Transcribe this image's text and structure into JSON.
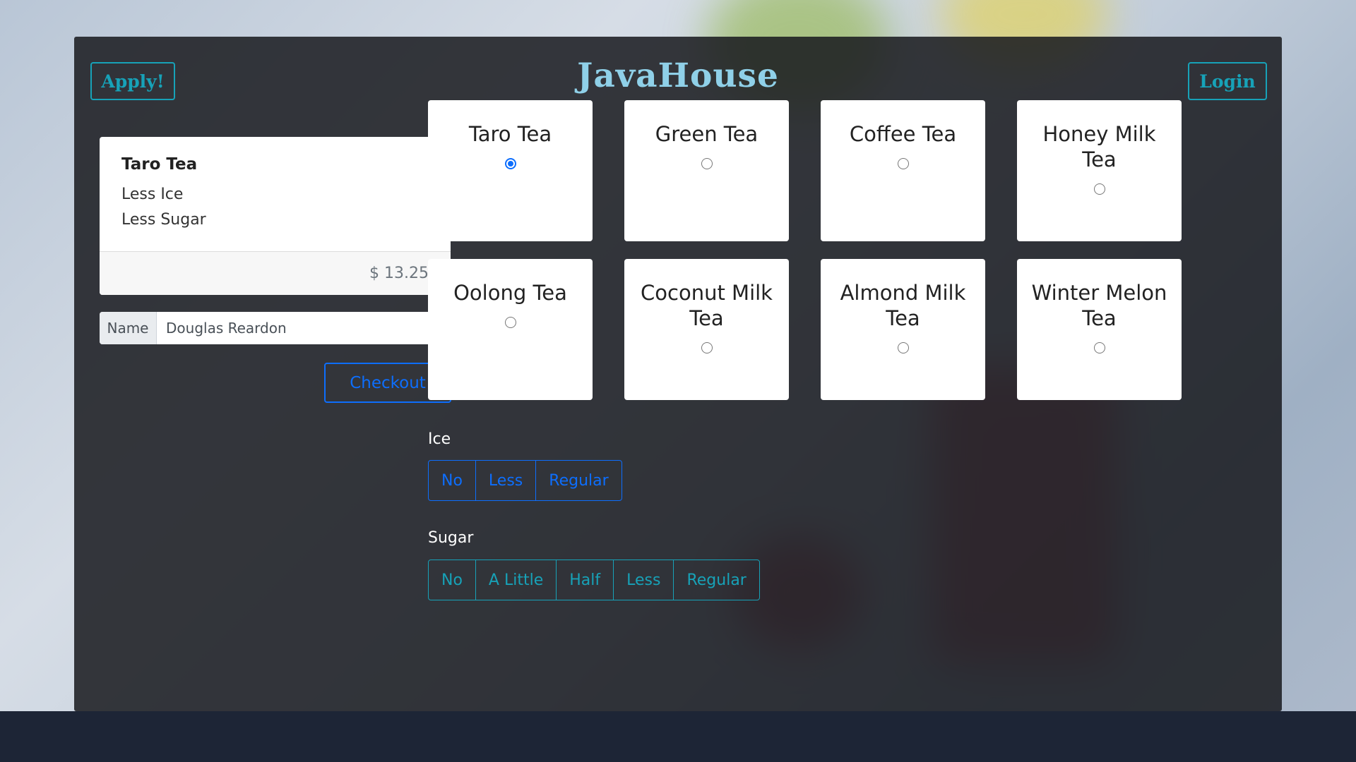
{
  "header": {
    "brand": "JavaHouse",
    "apply_label": "Apply!",
    "login_label": "Login"
  },
  "order": {
    "item": "Taro Tea",
    "ice": "Less Ice",
    "sugar": "Less Sugar",
    "price": "$ 13.25"
  },
  "name_field": {
    "label": "Name",
    "value": "Douglas Reardon"
  },
  "checkout_label": "Checkout",
  "teas": [
    {
      "name": "Taro Tea",
      "selected": true
    },
    {
      "name": "Green Tea",
      "selected": false
    },
    {
      "name": "Coffee Tea",
      "selected": false
    },
    {
      "name": "Honey Milk Tea",
      "selected": false
    },
    {
      "name": "Oolong Tea",
      "selected": false
    },
    {
      "name": "Coconut Milk Tea",
      "selected": false
    },
    {
      "name": "Almond Milk Tea",
      "selected": false
    },
    {
      "name": "Winter Melon Tea",
      "selected": false
    }
  ],
  "ice": {
    "label": "Ice",
    "options": [
      "No",
      "Less",
      "Regular"
    ]
  },
  "sugar": {
    "label": "Sugar",
    "options": [
      "No",
      "A Little",
      "Half",
      "Less",
      "Regular"
    ]
  },
  "colors": {
    "primary": "#0d6efd",
    "info": "#17a2b8",
    "brand": "#8fd0e8",
    "panel": "#181a1e",
    "footer": "#1d2536"
  }
}
